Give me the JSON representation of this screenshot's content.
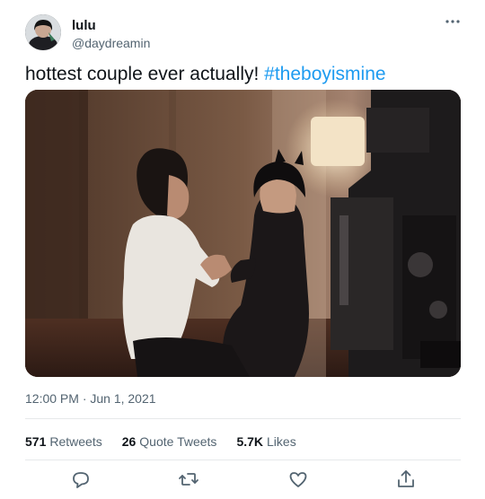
{
  "tweet": {
    "author": {
      "name": "lulu",
      "handle": "@daydreamin"
    },
    "text": "hottest couple ever actually! ",
    "hashtag": "#theboyismine",
    "timestamp": "12:00 PM · Jun 1, 2021",
    "stats": {
      "retweets": {
        "count": "571",
        "label": "Retweets"
      },
      "quote_tweets": {
        "count": "26",
        "label": "Quote Tweets"
      },
      "likes": {
        "count": "5.7K",
        "label": "Likes"
      }
    },
    "actions": [
      "reply-icon",
      "retweet-icon",
      "like-icon",
      "share-icon"
    ],
    "colors": {
      "accent": "#1d9bf0",
      "secondary_text": "#536471",
      "divider": "#e6e9ea"
    }
  }
}
